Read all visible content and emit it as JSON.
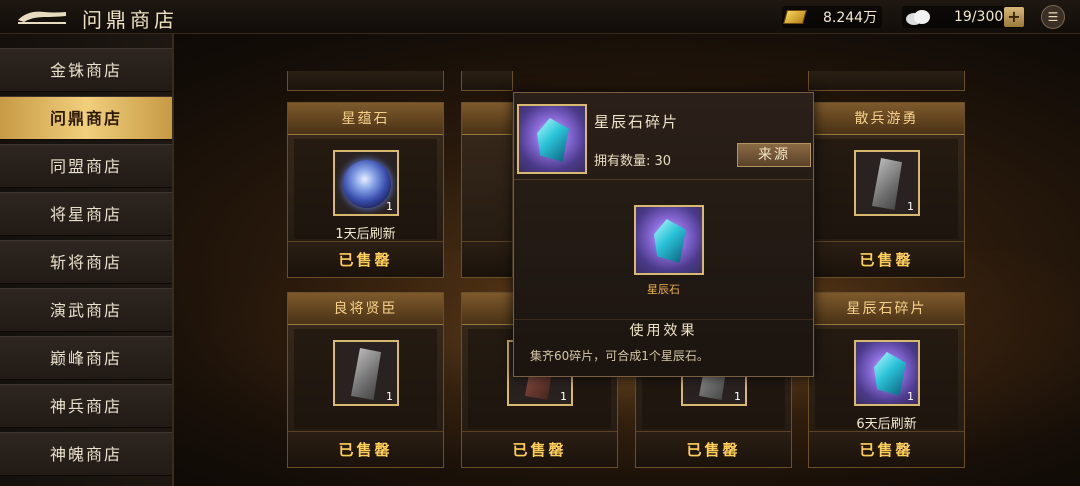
{
  "header": {
    "title": "问鼎商店",
    "gold_value": "8.244万",
    "stamina_value": "19/300",
    "plus_label": "+",
    "menu_glyph": "☰"
  },
  "sidebar": {
    "items": [
      {
        "label": "金铢商店"
      },
      {
        "label": "问鼎商店",
        "active": true
      },
      {
        "label": "同盟商店"
      },
      {
        "label": "将星商店"
      },
      {
        "label": "斩将商店"
      },
      {
        "label": "演武商店"
      },
      {
        "label": "巅峰商店"
      },
      {
        "label": "神兵商店"
      },
      {
        "label": "神魄商店"
      }
    ]
  },
  "cards": {
    "c1": {
      "title": "星蕴石",
      "count": "1",
      "refresh": "1天后刷新",
      "sold": "已售罄",
      "icon": "star-orb-icon"
    },
    "c2": {
      "title": "",
      "sold": "",
      "icon": "crystal-icon"
    },
    "c3": {
      "title": "",
      "sold": "",
      "icon": "crystal-icon"
    },
    "c4": {
      "title": "散兵游勇",
      "count": "1",
      "sold": "已售罄",
      "icon": "token-icon"
    },
    "c5": {
      "title": "良将贤臣",
      "count": "1",
      "sold": "已售罄",
      "icon": "token-icon"
    },
    "c6": {
      "title": "",
      "count": "1",
      "sold": "已售罄",
      "icon": "token-red-icon"
    },
    "c7": {
      "title": "",
      "count": "1",
      "sold": "已售罄",
      "icon": "token-icon"
    },
    "c8": {
      "title": "星辰石碎片",
      "count": "1",
      "refresh": "6天后刷新",
      "sold": "已售罄",
      "icon": "crystal-icon"
    }
  },
  "popup": {
    "name": "星辰石碎片",
    "owned": "拥有数量: 30",
    "source_button": "来源",
    "result_label": "星辰石",
    "effect_title": "使用效果",
    "effect_text": "集齐60碎片，可合成1个星辰石。"
  },
  "colors": {
    "accent_gold": "#f1cf7c",
    "sold_text": "#ffcf5a",
    "card_title_text": "#f6d08a"
  }
}
